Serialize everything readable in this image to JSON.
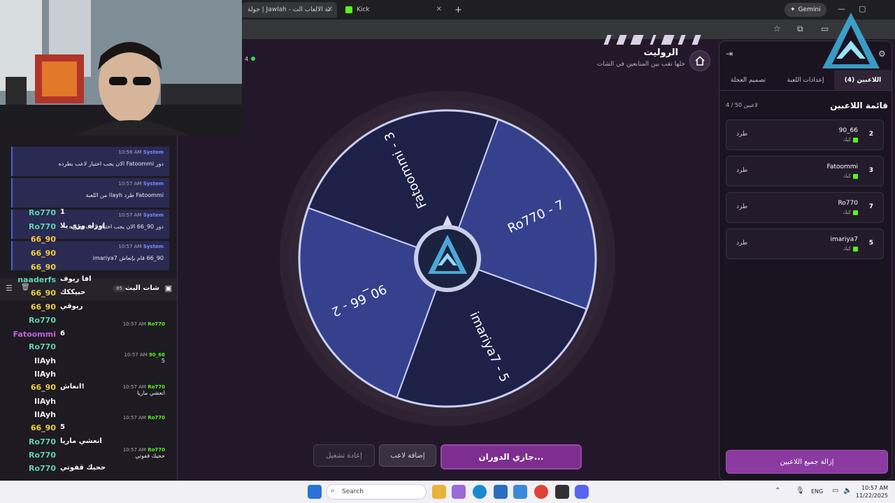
{
  "browser": {
    "tabs": [
      {
        "label": "جولة | Jawlah - منصة الألعاب الت",
        "active": true
      },
      {
        "label": "Kick",
        "active": false
      }
    ],
    "gemini_label": "Gemini"
  },
  "page": {
    "title": "الروليت",
    "subtitle": "خلها تقب بين المتابعين في الشات",
    "online_count": "4"
  },
  "wheel": {
    "segments": [
      {
        "label": "Ro770 - 7",
        "color": "#35418d"
      },
      {
        "label": "imariya7 - 5",
        "color": "#1d2148"
      },
      {
        "label": "90_66 - 2",
        "color": "#35418d"
      },
      {
        "label": "Fatoommi - 3",
        "color": "#1d2148"
      }
    ]
  },
  "buttons": {
    "spin": "جاري الدوران...",
    "add_player": "إضافة لاعب",
    "reset": "إعادة تشغيل",
    "remove_all": "إزالة جميع اللاعبين"
  },
  "panel": {
    "tabs": [
      "اللاعبين (4)",
      "إعدادات اللعبة",
      "تصميم العجلة"
    ],
    "list_title": "قائمة اللاعبين",
    "list_count": "4 / 50 لاعبين",
    "kick_action": "طرد",
    "platform_label": "كيك",
    "players": [
      {
        "number": "2",
        "name": "90_66"
      },
      {
        "number": "3",
        "name": "Fatoommi"
      },
      {
        "number": "7",
        "name": "Ro770"
      },
      {
        "number": "5",
        "name": "imariya7"
      }
    ]
  },
  "chat": {
    "title": "شات البث",
    "badge": "85",
    "system_messages": [
      {
        "user": "System",
        "time": "10:56 AM",
        "text": "دور Fatoommi الان يجب اختيار لاعب بطرده"
      },
      {
        "user": "System",
        "time": "10:57 AM",
        "text": "Fatoommi طرد llayh من اللعبة"
      },
      {
        "user": "System",
        "time": "10:57 AM",
        "text": "دور 90_66 الان يجب اختيار لاعب بطرده"
      },
      {
        "user": "System",
        "time": "10:57 AM",
        "text": "90_66 قام بإنعاش imariya7"
      }
    ],
    "messages": [
      {
        "user": "Ro770",
        "time": "10:57 AM",
        "text": ""
      },
      {
        "user": "90_66",
        "time": "10:57 AM",
        "text": "5"
      },
      {
        "user": "Ro770",
        "time": "10:57 AM",
        "text": "انعشي ماريا"
      },
      {
        "user": "Ro770",
        "time": "10:57 AM",
        "text": ""
      },
      {
        "user": "Ro770",
        "time": "10:57 AM",
        "text": "ححيك قفوتي"
      }
    ],
    "overlay_lines": [
      {
        "name": "Ro770",
        "text": "1",
        "color": "#5fd3b0"
      },
      {
        "name": "Ro770",
        "text": "اوراه وزي يلا",
        "color": "#5fd3b0"
      },
      {
        "name": "66_90",
        "text": "",
        "color": "#f0d040"
      },
      {
        "name": "66_90",
        "text": "",
        "color": "#f0d040"
      },
      {
        "name": "66_90",
        "text": "",
        "color": "#f0d040"
      },
      {
        "name": "naaderfs",
        "text": "افا ريوف",
        "color": "#5fd3b0"
      },
      {
        "name": "66_90",
        "text": "حبيككك",
        "color": "#f0d040"
      },
      {
        "name": "66_90",
        "text": "ريوقي",
        "color": "#f0d040"
      },
      {
        "name": "Ro770",
        "text": "",
        "color": "#5fd3b0"
      },
      {
        "name": "Fatoommi",
        "text": "6",
        "color": "#c060e0"
      },
      {
        "name": "Ro770",
        "text": "",
        "color": "#5fd3b0"
      },
      {
        "name": "IlAyh",
        "text": "",
        "color": "#f0f0f0"
      },
      {
        "name": "IlAyh",
        "text": "",
        "color": "#f0f0f0"
      },
      {
        "name": "66_90",
        "text": "انعاش!",
        "color": "#f0d040"
      },
      {
        "name": "IlAyh",
        "text": "",
        "color": "#f0f0f0"
      },
      {
        "name": "IlAyh",
        "text": "",
        "color": "#f0f0f0"
      },
      {
        "name": "66_90",
        "text": "5",
        "color": "#f0d040"
      },
      {
        "name": "Ro770",
        "text": "انعشي ماريا",
        "color": "#5fd3b0"
      },
      {
        "name": "Ro770",
        "text": "",
        "color": "#5fd3b0"
      },
      {
        "name": "Ro770",
        "text": "ححيك قفوتي",
        "color": "#5fd3b0"
      }
    ]
  },
  "taskbar": {
    "search_placeholder": "Search",
    "lang": "ENG",
    "time": "10:57 AM",
    "date": "11/22/2025"
  }
}
